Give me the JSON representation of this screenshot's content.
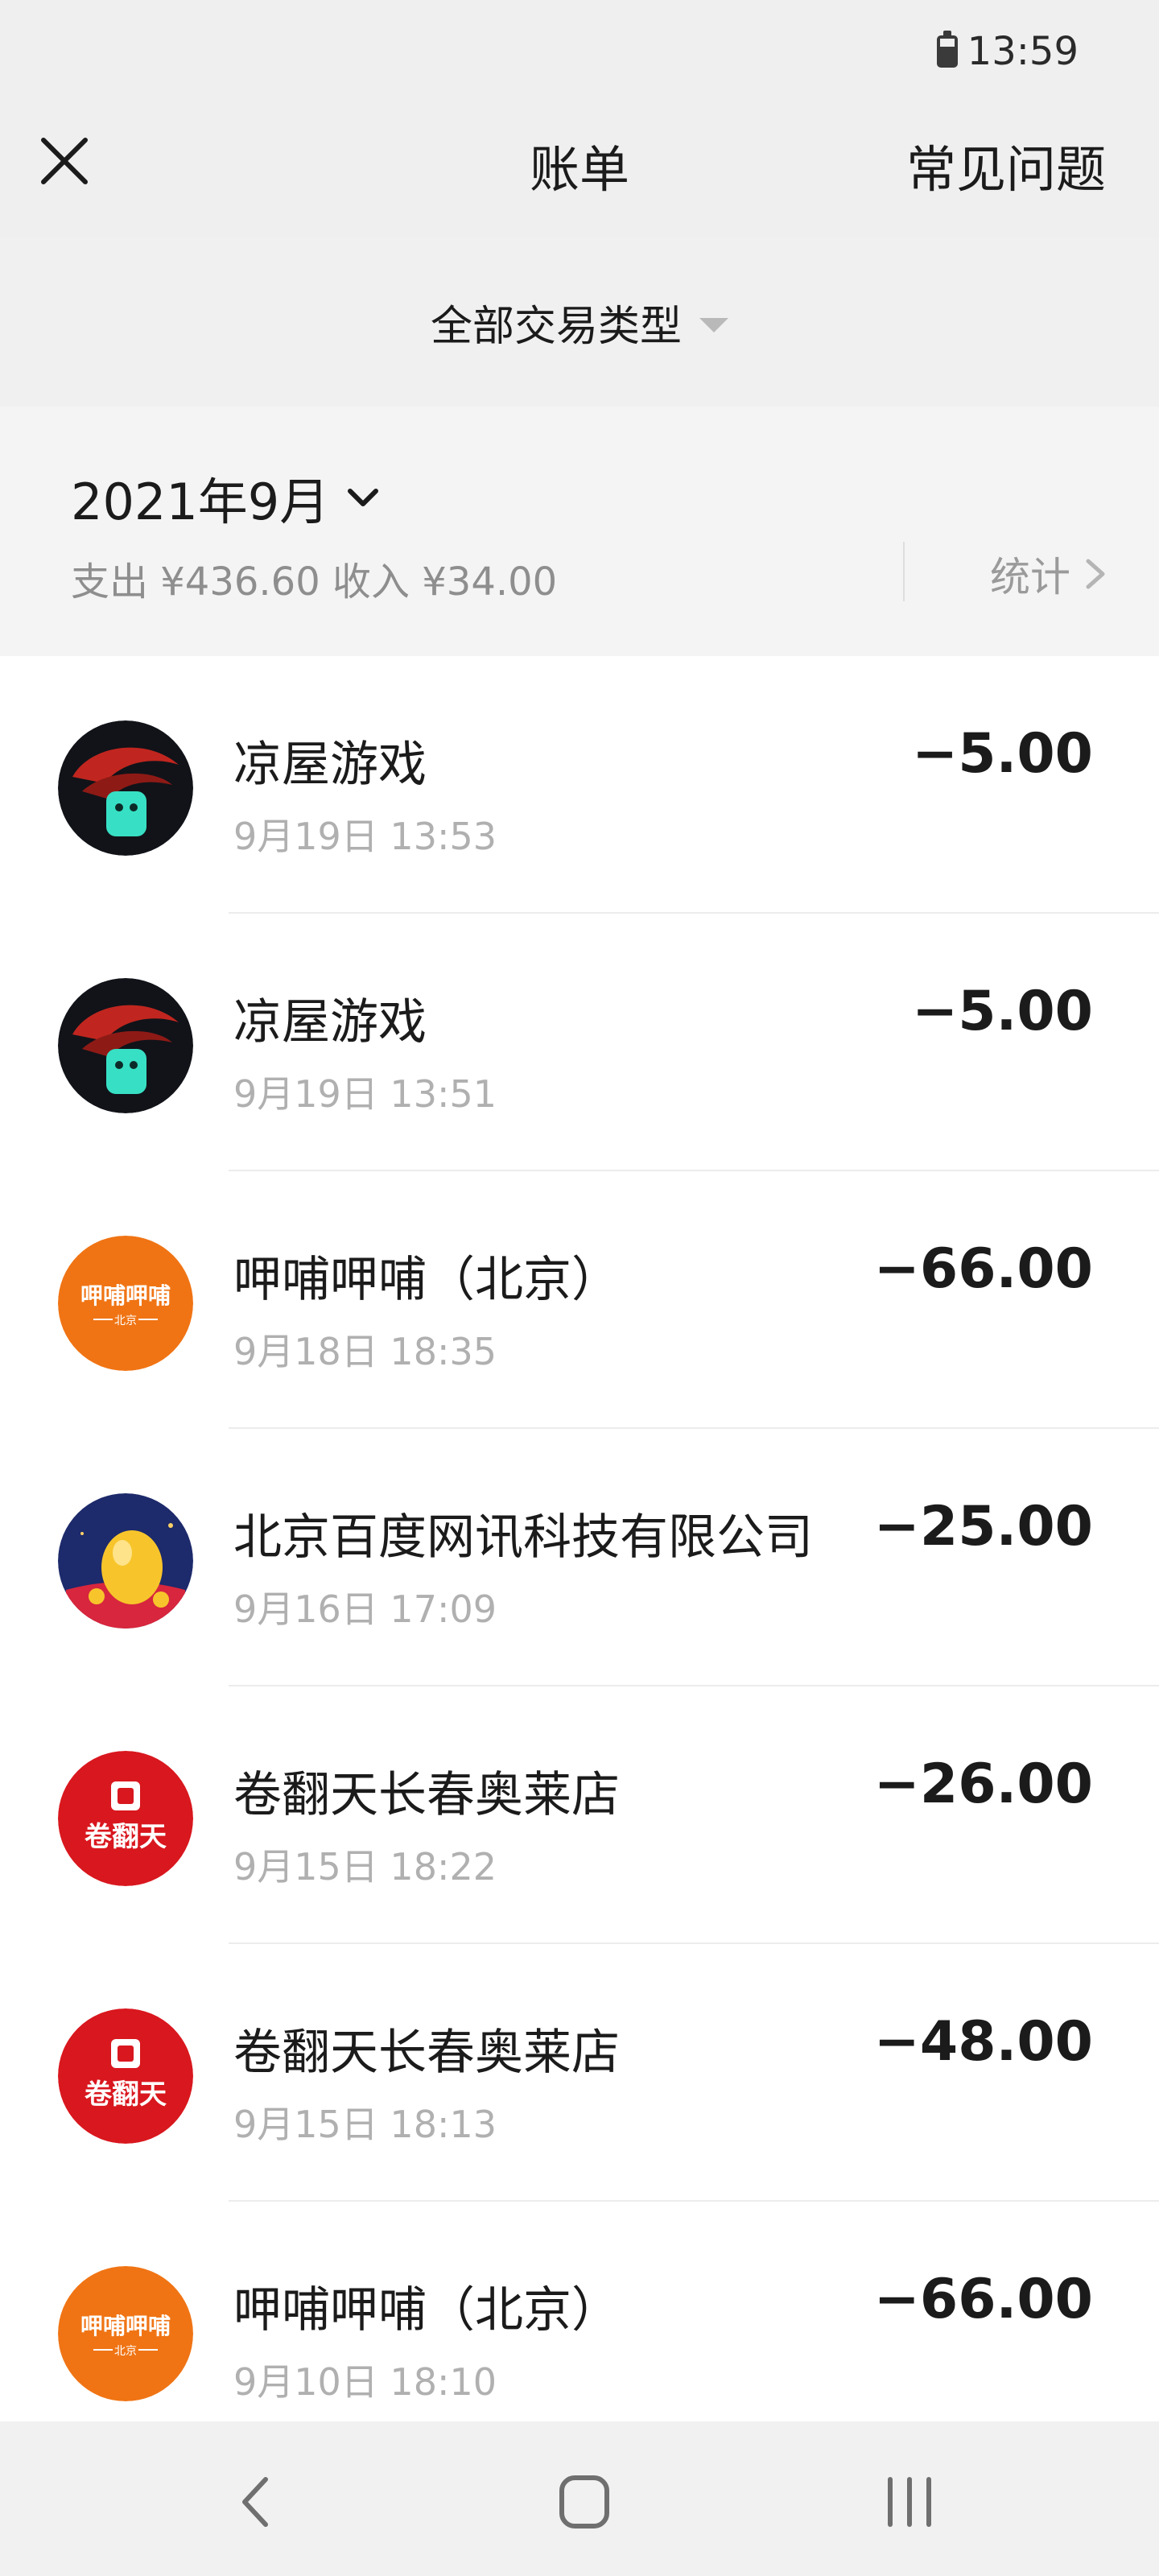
{
  "status_bar": {
    "time": "13:59"
  },
  "nav": {
    "title": "账单",
    "faq": "常见问题"
  },
  "filter": {
    "label": "全部交易类型"
  },
  "month": {
    "label": "2021年9月",
    "summary": "支出 ¥436.60 收入 ¥34.00",
    "stats_label": "统计"
  },
  "transactions": [
    {
      "name": "凉屋游戏",
      "time": "9月19日 13:53",
      "amount": "−5.00",
      "icon": "game-avatar"
    },
    {
      "name": "凉屋游戏",
      "time": "9月19日 13:51",
      "amount": "−5.00",
      "icon": "game-avatar"
    },
    {
      "name": "呷哺呷哺（北京）",
      "time": "9月18日 18:35",
      "amount": "−66.00",
      "icon": "xiabu-logo",
      "logo_text": "呷哺呷哺",
      "logo_sub": "北京"
    },
    {
      "name": "北京百度网讯科技有限公司",
      "time": "9月16日 17:09",
      "amount": "−25.00",
      "icon": "baidu-egg-avatar"
    },
    {
      "name": "卷翻天长春奥莱店",
      "time": "9月15日 18:22",
      "amount": "−26.00",
      "icon": "juanfantian-logo",
      "logo_text": "卷翻天"
    },
    {
      "name": "卷翻天长春奥莱店",
      "time": "9月15日 18:13",
      "amount": "−48.00",
      "icon": "juanfantian-logo",
      "logo_text": "卷翻天"
    },
    {
      "name": "呷哺呷哺（北京）",
      "time": "9月10日 18:10",
      "amount": "−66.00",
      "icon": "xiabu-logo",
      "logo_text": "呷哺呷哺",
      "logo_sub": "北京"
    }
  ],
  "colors": {
    "header_bg": "#efefef",
    "xiabu_orange": "#f07414",
    "juanfantian_red": "#d9171e",
    "game_teal": "#3fe6c8"
  }
}
